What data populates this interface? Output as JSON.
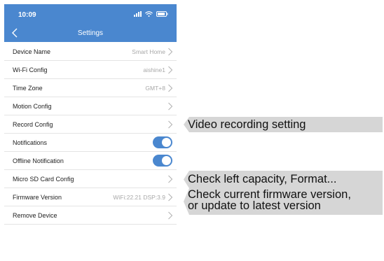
{
  "status_bar": {
    "time": "10:09",
    "icons": [
      "signal-icon",
      "wifi-icon",
      "battery-icon"
    ]
  },
  "header": {
    "title": "Settings",
    "back_icon": "chevron-left-icon",
    "color": "#4a87cf"
  },
  "settings": [
    {
      "label": "Device Name",
      "value": "Smart Home",
      "control": "chevron"
    },
    {
      "label": "Wi-Fi Config",
      "value": "aishine1",
      "control": "chevron"
    },
    {
      "label": "Time Zone",
      "value": "GMT+8",
      "control": "chevron"
    },
    {
      "label": "Motion Config",
      "value": "",
      "control": "chevron"
    },
    {
      "label": "Record Config",
      "value": "",
      "control": "chevron"
    },
    {
      "label": "Notifications",
      "value": "",
      "control": "toggle",
      "on": true
    },
    {
      "label": "Offline Notification",
      "value": "",
      "control": "toggle",
      "on": true
    },
    {
      "label": "Micro SD Card Config",
      "value": "",
      "control": "chevron"
    },
    {
      "label": "Firmware Version",
      "value": "WiFi:22.21 DSP:3.9",
      "control": "chevron"
    },
    {
      "label": "Remove Device",
      "value": "",
      "control": "chevron"
    }
  ],
  "annotations": {
    "record": "Video recording setting",
    "sdcard": "Check left capacity, Format...",
    "firmware_line1": "Check current firmware version,",
    "firmware_line2": "or update to latest version"
  }
}
